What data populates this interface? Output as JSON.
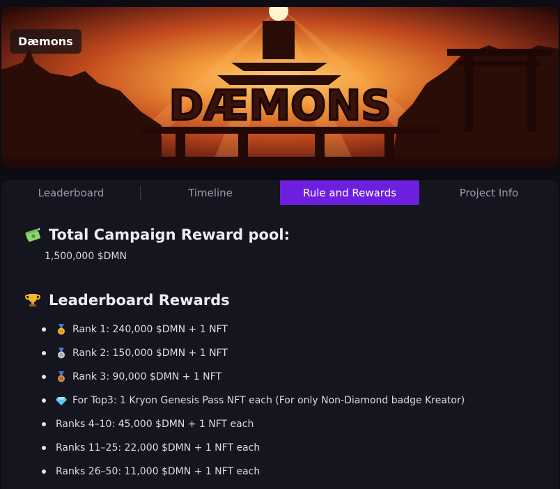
{
  "banner": {
    "badge": "Dæmons",
    "logo_text": "DÆMONS"
  },
  "tabs": [
    {
      "label": "Leaderboard",
      "active": false
    },
    {
      "label": "Timeline",
      "active": false
    },
    {
      "label": "Rule and Rewards",
      "active": true
    },
    {
      "label": "Project Info",
      "active": false
    }
  ],
  "pool": {
    "icon": "money-with-wings-icon",
    "title": "Total Campaign Reward pool:",
    "value": "1,500,000 $DMN"
  },
  "leaderboard": {
    "icon": "trophy-icon",
    "title": "Leaderboard Rewards",
    "items": [
      {
        "icon": "gold-medal-icon",
        "text": "Rank 1: 240,000 $DMN + 1 NFT"
      },
      {
        "icon": "silver-medal-icon",
        "text": "Rank 2: 150,000 $DMN + 1 NFT"
      },
      {
        "icon": "bronze-medal-icon",
        "text": "Rank 3: 90,000 $DMN + 1 NFT"
      },
      {
        "icon": "diamond-icon",
        "text": "For Top3: 1 Kryon Genesis Pass NFT each (For only Non-Diamond badge Kreator)"
      },
      {
        "icon": "",
        "text": "Ranks 4–10: 45,000 $DMN + 1 NFT each"
      },
      {
        "icon": "",
        "text": "Ranks 11–25: 22,000 $DMN + 1 NFT each"
      },
      {
        "icon": "",
        "text": "Ranks 26–50: 11,000 $DMN + 1 NFT each"
      }
    ]
  },
  "colors": {
    "accent": "#6d1fe0",
    "background": "#0c0c12",
    "panel": "#15151f"
  }
}
